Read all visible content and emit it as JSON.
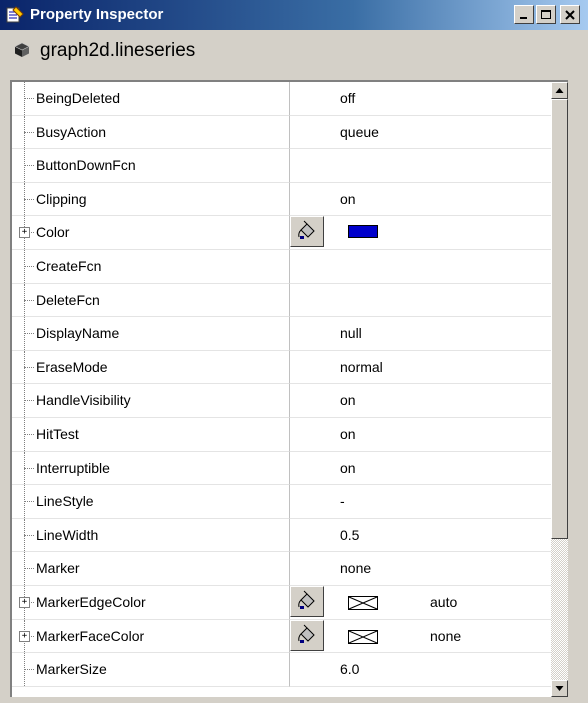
{
  "window": {
    "title": "Property Inspector",
    "buttons": [
      "minimize",
      "maximize",
      "close"
    ]
  },
  "object": {
    "icon": "object-cube-icon",
    "label": "graph2d.lineseries"
  },
  "properties": [
    {
      "name": "BeingDeleted",
      "value": "off",
      "editor": "dropdown",
      "expandable": false
    },
    {
      "name": "BusyAction",
      "value": "queue",
      "editor": "dropdown",
      "expandable": false
    },
    {
      "name": "ButtonDownFcn",
      "value": "",
      "editor": "pencil",
      "expandable": false
    },
    {
      "name": "Clipping",
      "value": "on",
      "editor": "dropdown",
      "expandable": false
    },
    {
      "name": "Color",
      "value": "",
      "editor": "color",
      "swatch": "#0000cc",
      "expandable": true
    },
    {
      "name": "CreateFcn",
      "value": "",
      "editor": "pencil",
      "expandable": false
    },
    {
      "name": "DeleteFcn",
      "value": "",
      "editor": "pencil",
      "expandable": false
    },
    {
      "name": "DisplayName",
      "value": "null",
      "editor": "pencil",
      "expandable": false
    },
    {
      "name": "EraseMode",
      "value": "normal",
      "editor": "dropdown",
      "expandable": false
    },
    {
      "name": "HandleVisibility",
      "value": "on",
      "editor": "dropdown",
      "expandable": false
    },
    {
      "name": "HitTest",
      "value": "on",
      "editor": "dropdown",
      "expandable": false
    },
    {
      "name": "Interruptible",
      "value": "on",
      "editor": "dropdown",
      "expandable": false
    },
    {
      "name": "LineStyle",
      "value": "-",
      "editor": "dropdown",
      "expandable": false
    },
    {
      "name": "LineWidth",
      "value": "0.5",
      "editor": "pencil",
      "expandable": false
    },
    {
      "name": "Marker",
      "value": "none",
      "editor": "dropdown",
      "expandable": false
    },
    {
      "name": "MarkerEdgeColor",
      "value": "auto",
      "editor": "color",
      "swatch": "none",
      "expandable": true
    },
    {
      "name": "MarkerFaceColor",
      "value": "none",
      "editor": "color",
      "swatch": "none",
      "expandable": true
    },
    {
      "name": "MarkerSize",
      "value": "6.0",
      "editor": "pencil",
      "expandable": false
    }
  ],
  "colors": {
    "titlebar_start": "#0a246a",
    "titlebar_end": "#a6caf0",
    "face": "#d4d0c8",
    "grid_bg": "#ffffff"
  }
}
